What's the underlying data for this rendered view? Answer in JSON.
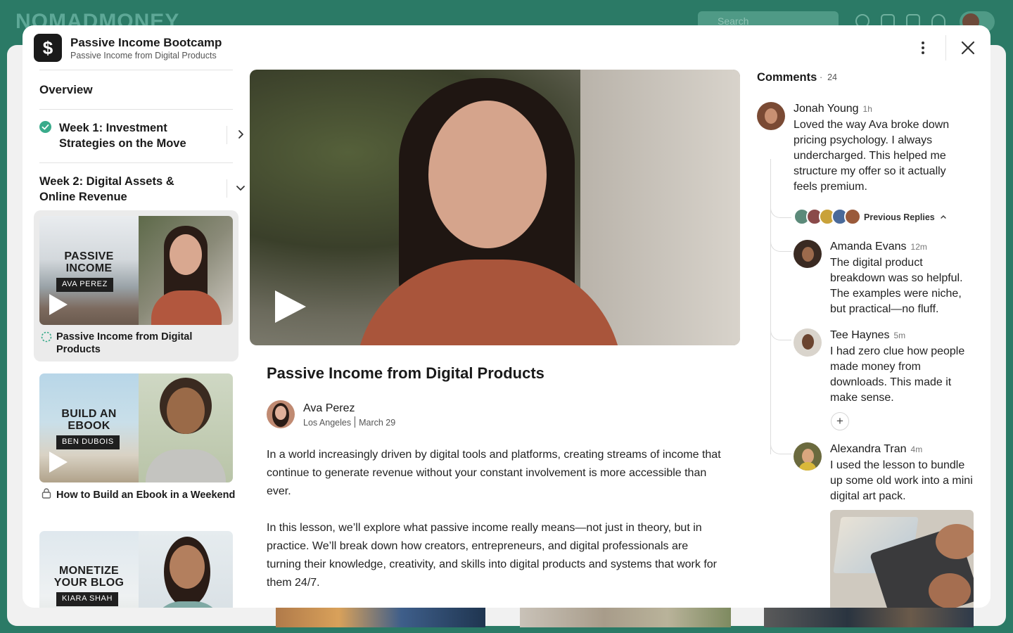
{
  "background": {
    "logo": "NOMADMONEY",
    "search_placeholder": "Search"
  },
  "modal": {
    "course_title": "Passive Income Bootcamp",
    "course_subtitle": "Passive Income from Digital Products",
    "course_logo_glyph": "$"
  },
  "sidebar": {
    "overview": "Overview",
    "week1": "Week 1: Investment Strategies on the Move",
    "week2": "Week 2: Digital Assets & Online Revenue",
    "lessons": [
      {
        "thumb_line1": "PASSIVE",
        "thumb_line2": "INCOME",
        "thumb_tag": "AVA PEREZ",
        "label": "Passive Income from Digital Products",
        "state": "in-progress"
      },
      {
        "thumb_line1": "BUILD AN",
        "thumb_line2": "EBOOK",
        "thumb_tag": "BEN DUBOIS",
        "label": "How to Build an Ebook in a Weekend",
        "state": "locked"
      },
      {
        "thumb_line1": "MONETIZE",
        "thumb_line2": "YOUR BLOG",
        "thumb_tag": "KIARA SHAH",
        "label": "",
        "state": "locked"
      }
    ]
  },
  "lesson": {
    "title": "Passive Income from Digital Products",
    "author": "Ava Perez",
    "location": "Los Angeles",
    "date": "March 29",
    "paragraph1": "In a world increasingly driven by digital tools and platforms, creating streams of income that continue to generate revenue without your constant involvement is more accessible than ever.",
    "paragraph2": "In this lesson, we’ll explore what passive income really means—not just in theory, but in practice. We’ll break down how creators, entrepreneurs, and digital professionals are turning their knowledge, creativity, and skills into digital products and systems that work for them 24/7."
  },
  "comments": {
    "heading": "Comments",
    "count": "24",
    "previous_replies": "Previous Replies",
    "items": [
      {
        "name": "Jonah Young",
        "time": "1h",
        "text": "Loved the way Ava broke down pricing psychology. I always undercharged. This helped me structure my offer so it actually feels premium."
      },
      {
        "name": "Amanda Evans",
        "time": "12m",
        "text": "The digital product breakdown was so helpful. The examples were niche, but practical—no fluff."
      },
      {
        "name": "Tee Haynes",
        "time": "5m",
        "text": "I had zero clue how people made money from downloads. This made it make sense."
      },
      {
        "name": "Alexandra Tran",
        "time": "4m",
        "text": "I used the lesson to bundle up some old work into a mini digital art pack."
      }
    ]
  },
  "colors": {
    "brand_green": "#2b7a66",
    "check_green": "#3aab8b"
  }
}
